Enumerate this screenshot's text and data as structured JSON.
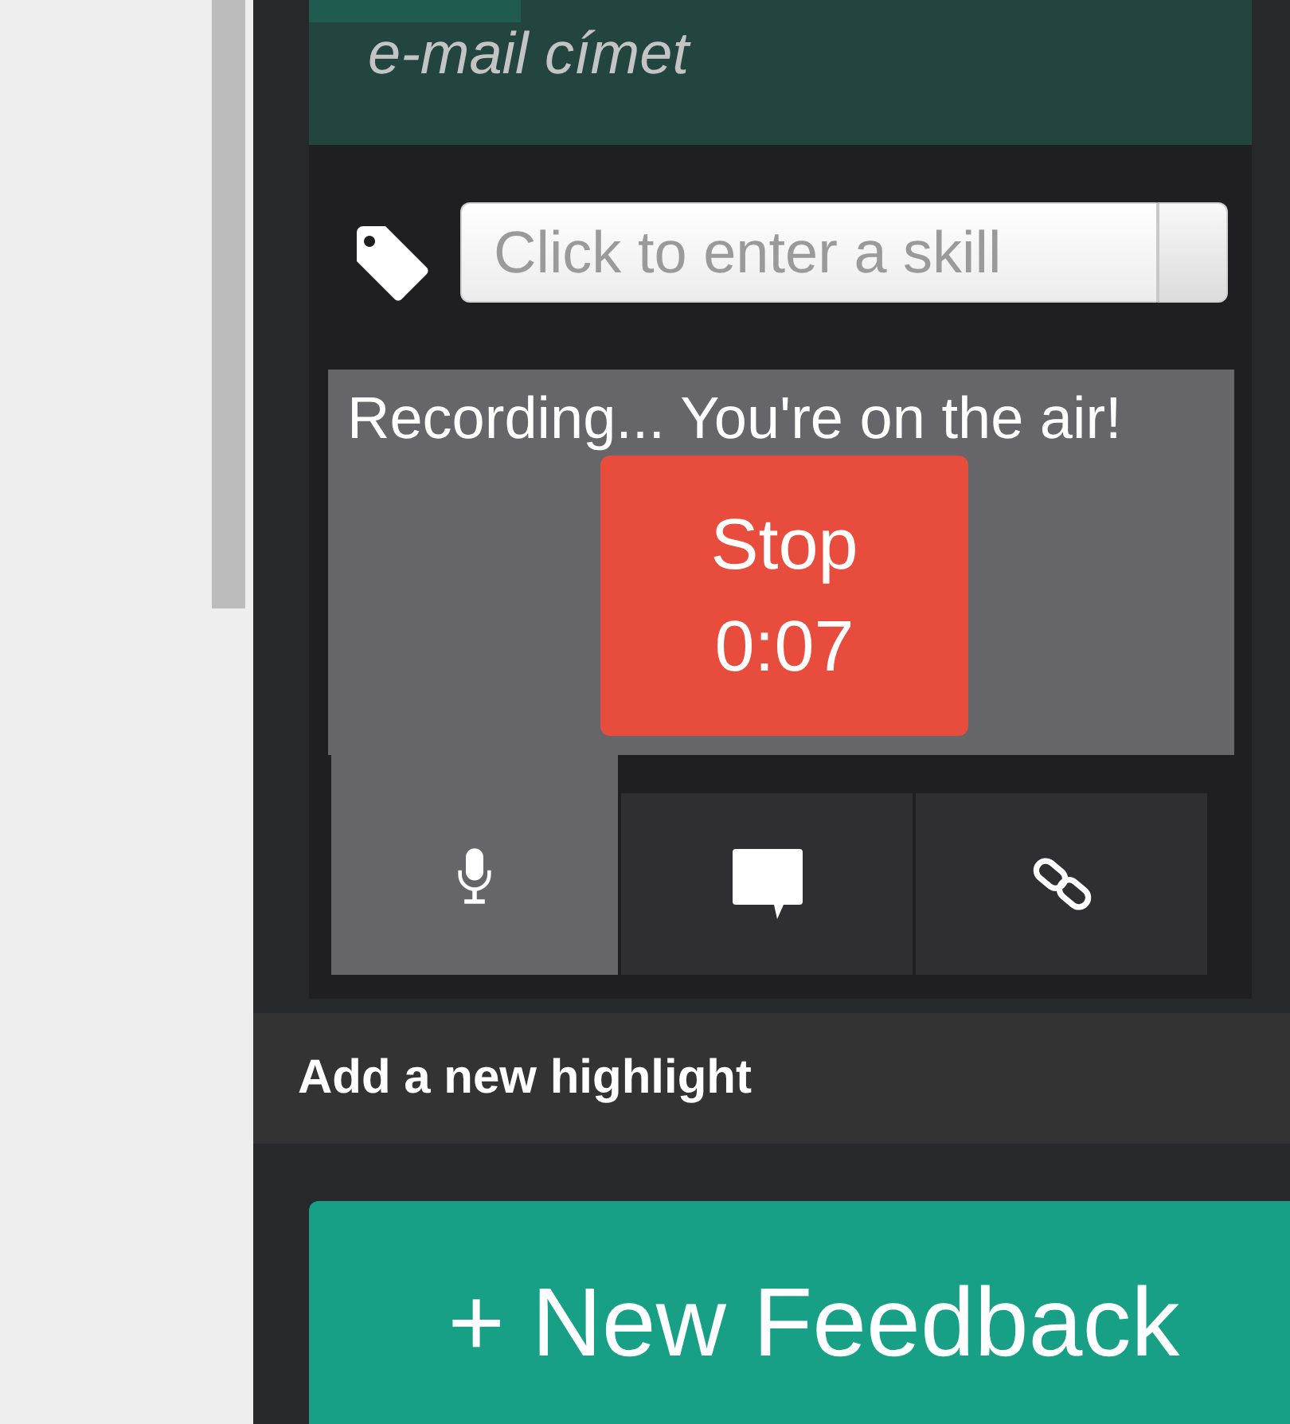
{
  "email_field": {
    "placeholder": "e-mail címet"
  },
  "skill_field": {
    "placeholder": "Click to enter a skill"
  },
  "recording": {
    "status": "Recording... You're on the air!",
    "stop_label": "Stop",
    "elapsed": "0:07"
  },
  "media_tabs": [
    {
      "kind": "voice",
      "selected": true
    },
    {
      "kind": "comment",
      "selected": false
    },
    {
      "kind": "link",
      "selected": false
    }
  ],
  "highlight_bar": {
    "title": "Add a new highlight"
  },
  "new_feedback_button": {
    "label": "+ New Feedback"
  }
}
